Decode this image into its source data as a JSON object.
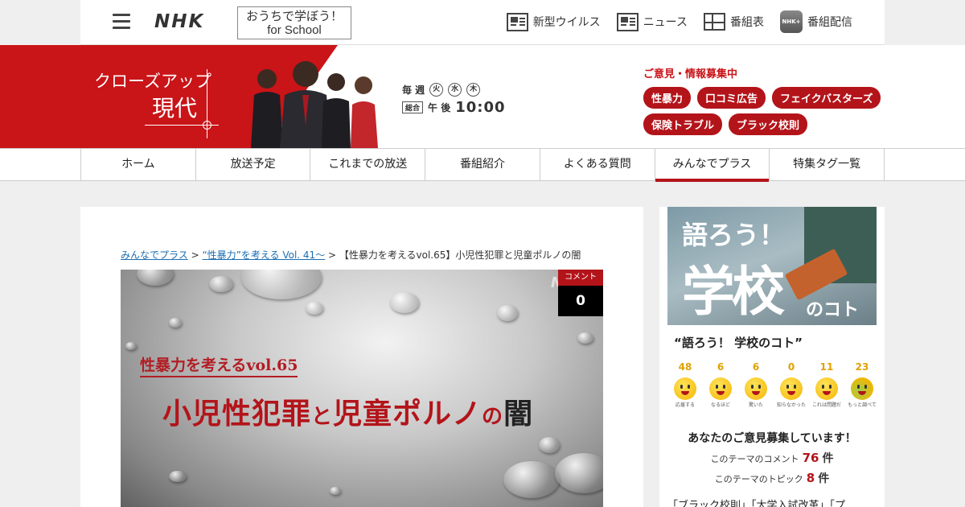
{
  "header": {
    "brand": "NHK",
    "school_line1": "おうちで学ぼう！",
    "school_line2": "for School",
    "nav": [
      {
        "label": "新型ウイルス",
        "icon": "news-icon"
      },
      {
        "label": "ニュース",
        "icon": "news-icon"
      },
      {
        "label": "番組表",
        "icon": "grid-icon"
      },
      {
        "label": "番組配信",
        "icon": "plus-app-icon"
      }
    ]
  },
  "banner": {
    "title_line1": "クローズアップ",
    "title_line2": "現代",
    "weekly": "毎 週",
    "days": [
      "火",
      "水",
      "木"
    ],
    "channel": "総合",
    "ampm": "午 後",
    "time": "10:00",
    "opinion_title": "ご意見・情報募集中",
    "tags": [
      "性暴力",
      "口コミ広告",
      "フェイクバスターズ",
      "保険トラブル",
      "ブラック校則"
    ]
  },
  "gnav": [
    "ホーム",
    "放送予定",
    "これまでの放送",
    "番組紹介",
    "よくある質問",
    "みんなでプラス",
    "特集タグ一覧"
  ],
  "gnav_active_index": 5,
  "breadcrumb": {
    "link1": "みんなでプラス",
    "sep": " > ",
    "link2": "“性暴力”を考える Vol. 41～",
    "current": "【性暴力を考えるvol.65】小児性犯罪と児童ポルノの闇"
  },
  "hero": {
    "watermark": "N",
    "subtitle": "性暴力を考えるvol.65",
    "main_a": "小児性犯罪",
    "main_to": "と",
    "main_b": "児童ポルノ",
    "main_no": "の",
    "main_c": "闇",
    "comment_label": "コメント",
    "comment_count": "0"
  },
  "sidebar": {
    "img_a": "語ろう！",
    "img_b": "学校",
    "img_c": "のコト",
    "title": "“語ろう！ 学校のコト”",
    "reactions": [
      {
        "count": "48",
        "label": "応援する"
      },
      {
        "count": "6",
        "label": "なるほど"
      },
      {
        "count": "6",
        "label": "驚いた"
      },
      {
        "count": "0",
        "label": "知らなかった"
      },
      {
        "count": "11",
        "label": "これは問題だ"
      },
      {
        "count": "23",
        "label": "もっと調べて"
      }
    ],
    "ask": "あなたのご意見募集しています！",
    "comments_label": "このテーマのコメント",
    "comments_count": "76",
    "topics_label": "このテーマのトピック",
    "topics_count": "8",
    "unit": "件",
    "theme_tags": "「ブラック校則」「大学入試改革」「プ"
  }
}
